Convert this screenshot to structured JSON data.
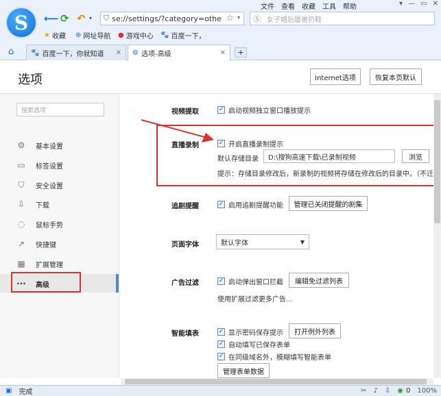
{
  "menubar": {
    "items": [
      "文件",
      "查看",
      "收藏",
      "工具",
      "帮助"
    ],
    "win": [
      "▾",
      "—",
      "▭",
      "✕"
    ]
  },
  "logo": "S",
  "address": {
    "url": "se://settings/?category=othe",
    "star": "☆",
    "drop": "▾"
  },
  "search": {
    "placeholder": "女子婚后屡被扔鞋"
  },
  "bookmarks": [
    {
      "icon": "★",
      "label": "收藏"
    },
    {
      "icon": "⊕",
      "label": "网址导航"
    },
    {
      "icon": "●",
      "label": "游戏中心"
    },
    {
      "icon": "🐾",
      "label": "百度一下，"
    }
  ],
  "tabs": [
    {
      "icon": "🐾",
      "label": "百度一下，你就知道"
    },
    {
      "icon": "⚙",
      "label": "选项-高级"
    }
  ],
  "page": {
    "title": "选项",
    "btn_internet": "Internet选项",
    "btn_restore": "恢复本页默认"
  },
  "sidebar": {
    "search_placeholder": "搜索选项",
    "items": [
      {
        "icon": "⚙",
        "label": "基本设置"
      },
      {
        "icon": "▭",
        "label": "标签设置"
      },
      {
        "icon": "⛉",
        "label": "安全设置"
      },
      {
        "icon": "⇩",
        "label": "下载"
      },
      {
        "icon": "◌",
        "label": "鼠标手势"
      },
      {
        "icon": "↗",
        "label": "快捷键"
      },
      {
        "icon": "▦",
        "label": "扩展管理"
      },
      {
        "icon": "···",
        "label": "高级"
      }
    ]
  },
  "sections": {
    "video": {
      "title": "视频提取",
      "opt": "启动视频独立窗口播放提示"
    },
    "live": {
      "title": "直播录制",
      "opt": "开启直播录制提示",
      "dir_label": "默认存储目录",
      "dir_value": "D:\\搜狗高速下载\\已录制视频",
      "browse": "浏览",
      "tip": "提示：存储目录修改后，新录制的视频将存储在修改后的目录中。（不迁移"
    },
    "drama": {
      "title": "追剧提醒",
      "opt": "启用追剧提醒功能",
      "btn": "管理已关闭提醒的剧集"
    },
    "font": {
      "title": "页面字体",
      "value": "默认字体"
    },
    "ads": {
      "title": "广告过滤",
      "opt": "启动弹出窗口拦截",
      "btn": "编辑免过滤列表",
      "note": "使用扩展过滤更多广告..."
    },
    "autofill": {
      "title": "智能填表",
      "opt1": "显示密码保存提示",
      "btn1": "打开例外列表",
      "opt2": "自动填写已保存表单",
      "opt3": "在同级域名外，模糊填写智能表单",
      "btn2": "管理表单数据"
    }
  },
  "status": {
    "text": "完成",
    "zoom": "100%"
  }
}
